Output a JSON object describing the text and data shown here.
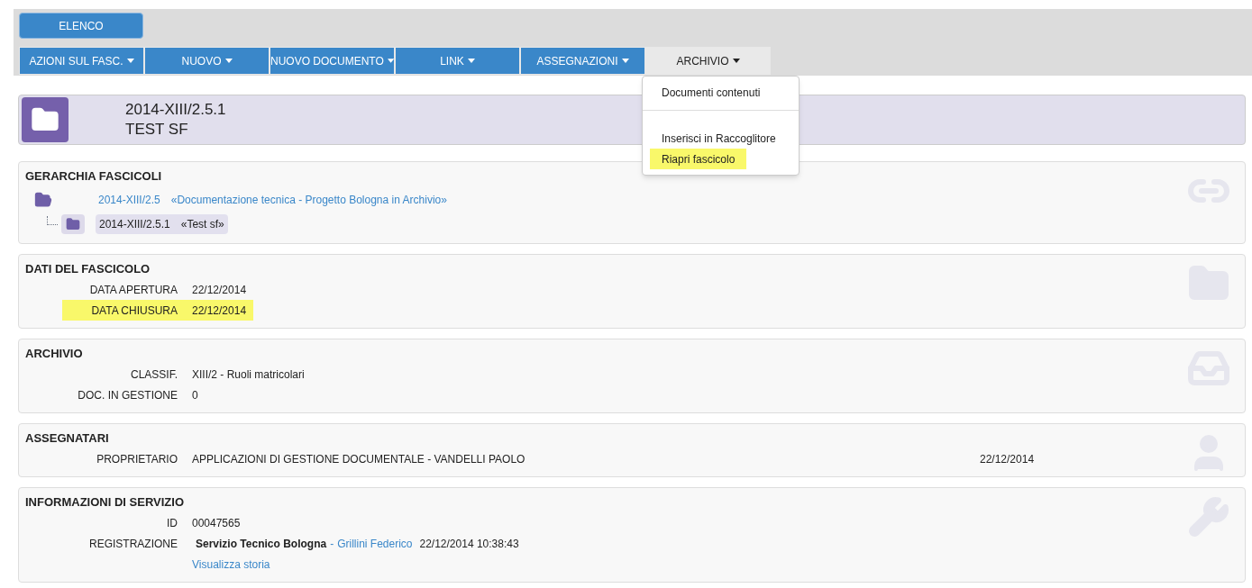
{
  "top_button": {
    "label": "ELENCO"
  },
  "toolbar": [
    {
      "label": "AZIONI SUL FASC.",
      "selected": false
    },
    {
      "label": "NUOVO",
      "selected": false
    },
    {
      "label": "NUOVO DOCUMENTO",
      "selected": false
    },
    {
      "label": "LINK",
      "selected": false
    },
    {
      "label": "ASSEGNAZIONI",
      "selected": false
    },
    {
      "label": "ARCHIVIO",
      "selected": true
    }
  ],
  "dropdown": {
    "items": [
      {
        "label": "Documenti contenuti",
        "separator_before": false,
        "highlighted": false
      },
      {
        "label": "Inserisci in Raccoglitore",
        "separator_before": true,
        "highlighted": false
      },
      {
        "label": "Riapri fascicolo",
        "separator_before": false,
        "highlighted": true
      }
    ]
  },
  "header": {
    "code": "2014-XIII/2.5.1",
    "title": "TEST SF"
  },
  "sections": [
    {
      "title": "GERARCHIA FASCICOLI",
      "kind": "hierarchy",
      "tree": [
        {
          "code": "2014-XIII/2.5",
          "description": "«Documentazione tecnica - Progetto Bologna in Archivio»",
          "current": false,
          "children": [
            {
              "code": "2014-XIII/2.5.1",
              "description": "«Test sf»",
              "current": true
            }
          ]
        }
      ]
    },
    {
      "title": "DATI DEL FASCICOLO",
      "kind": "data",
      "rows": [
        {
          "kind": "plain",
          "label": "DATA APERTURA",
          "value": "22/12/2014",
          "highlighted": false
        },
        {
          "kind": "plain",
          "label": "DATA CHIUSURA",
          "value": "22/12/2014",
          "highlighted": true
        }
      ]
    },
    {
      "title": "ARCHIVIO",
      "kind": "archive",
      "rows": [
        {
          "kind": "plain",
          "label": "CLASSIF.",
          "value": "XIII/2 - Ruoli matricolari",
          "highlighted": false
        },
        {
          "kind": "plain",
          "label": "DOC. IN GESTIONE",
          "value": "0",
          "highlighted": false
        }
      ]
    },
    {
      "title": "ASSEGNATARI",
      "kind": "assignees",
      "rows": [
        {
          "kind": "assignee",
          "label": "PROPRIETARIO",
          "value": "APPLICAZIONI DI GESTIONE DOCUMENTALE - VANDELLI PAOLO",
          "date": "22/12/2014"
        }
      ]
    },
    {
      "title": "INFORMAZIONI DI SERVIZIO",
      "kind": "service",
      "rows": [
        {
          "kind": "plain",
          "label": "ID",
          "value": "00047565",
          "highlighted": false
        },
        {
          "kind": "registration",
          "label": "REGISTRAZIONE",
          "office": "Servizio Tecnico Bologna",
          "separator": "-",
          "person": "Grillini Federico",
          "timestamp": "22/12/2014 10:38:43"
        },
        {
          "kind": "link",
          "value": "Visualizza storia"
        }
      ]
    }
  ]
}
